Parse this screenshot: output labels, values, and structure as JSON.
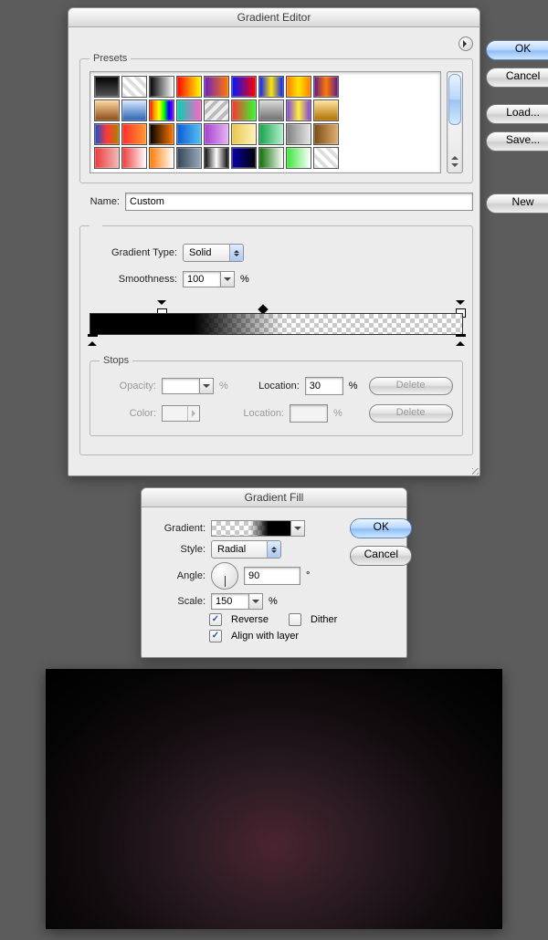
{
  "gradient_editor": {
    "title": "Gradient Editor",
    "presets_label": "Presets",
    "buttons": {
      "ok": "OK",
      "cancel": "Cancel",
      "load": "Load...",
      "save": "Save...",
      "new": "New"
    },
    "name_label": "Name:",
    "name_value": "Custom",
    "type_label": "Gradient Type:",
    "type_value": "Solid",
    "smoothness_label": "Smoothness:",
    "smoothness_value": "100",
    "percent": "%",
    "stops": {
      "legend": "Stops",
      "opacity_label": "Opacity:",
      "opacity_value": "",
      "opacity_location_label": "Location:",
      "opacity_location_value": "30",
      "color_label": "Color:",
      "color_location_label": "Location:",
      "color_location_value": "",
      "delete": "Delete"
    },
    "preset_swatches": [
      "linear-gradient(#000,#555)",
      "repeating-linear-gradient(45deg,#ddd 0 4px,#fff 4px 8px)",
      "linear-gradient(90deg,#000,#fff)",
      "linear-gradient(90deg,#f00,#ff0)",
      "linear-gradient(90deg,#7020c0,#ff7a00)",
      "linear-gradient(90deg,#0018ff,#ff0000)",
      "linear-gradient(90deg,#0018ff,#ffe600,#0018ff)",
      "linear-gradient(90deg,#ff7a00,#ffe600,#ff7a00)",
      "linear-gradient(90deg,#59178e,#ff7a00,#59178e)",
      "linear-gradient(#ffd9a0,#8c4a16)",
      "linear-gradient(#d6eaff,#2a62b4)",
      "linear-gradient(90deg,#ff0000,#ffa500,#ffff00,#00ff00,#0000ff,#8b00ff)",
      "linear-gradient(90deg,#00d0b0,#ff64c8)",
      "repeating-linear-gradient(135deg,#bbb 0 4px,#eee 4px 8px)",
      "linear-gradient(90deg,#ff3030,#30ff30)",
      "linear-gradient(#dcdcdc,#6e6e6e)",
      "linear-gradient(90deg,#7a3ee0,#ffef3e,#7a3ee0)",
      "linear-gradient(#ffe6a0,#b07000)",
      "linear-gradient(90deg,#1050d0,#ff3838,#b08000)",
      "linear-gradient(90deg,#ff2d2d,#ff9a2d)",
      "linear-gradient(90deg,#000,#ff7a00)",
      "linear-gradient(90deg,#0a5bd6,#58c0f0)",
      "linear-gradient(90deg,#a63fd0,#e7b6f3)",
      "linear-gradient(90deg,#e7c84a,#fff3bb)",
      "linear-gradient(90deg,#16a34a,#b6f0cf)",
      "linear-gradient(90deg,#808080,#e6e6e6)",
      "linear-gradient(90deg,#7a4a16,#e0b070)",
      "linear-gradient(90deg,#ee3a3a,#f0baba)",
      "linear-gradient(90deg,#ee3a3a,#fff)",
      "linear-gradient(90deg,#ff7a00,#fff)",
      "linear-gradient(90deg,#345,#9ab)",
      "linear-gradient(90deg,#000,#fff,#000)",
      "linear-gradient(90deg,#0a00aa,#000)",
      "linear-gradient(90deg,#0a6e00,#fff)",
      "linear-gradient(90deg,#39e639,#fff)",
      "repeating-linear-gradient(45deg,#ddd 0 4px,#fff 4px 8px)"
    ]
  },
  "gradient_fill": {
    "title": "Gradient Fill",
    "buttons": {
      "ok": "OK",
      "cancel": "Cancel"
    },
    "gradient_label": "Gradient:",
    "style_label": "Style:",
    "style_value": "Radial",
    "angle_label": "Angle:",
    "angle_value": "90",
    "angle_unit": "°",
    "scale_label": "Scale:",
    "scale_value": "150",
    "percent": "%",
    "reverse_label": "Reverse",
    "reverse_checked": true,
    "dither_label": "Dither",
    "dither_checked": false,
    "align_label": "Align with layer",
    "align_checked": true
  }
}
